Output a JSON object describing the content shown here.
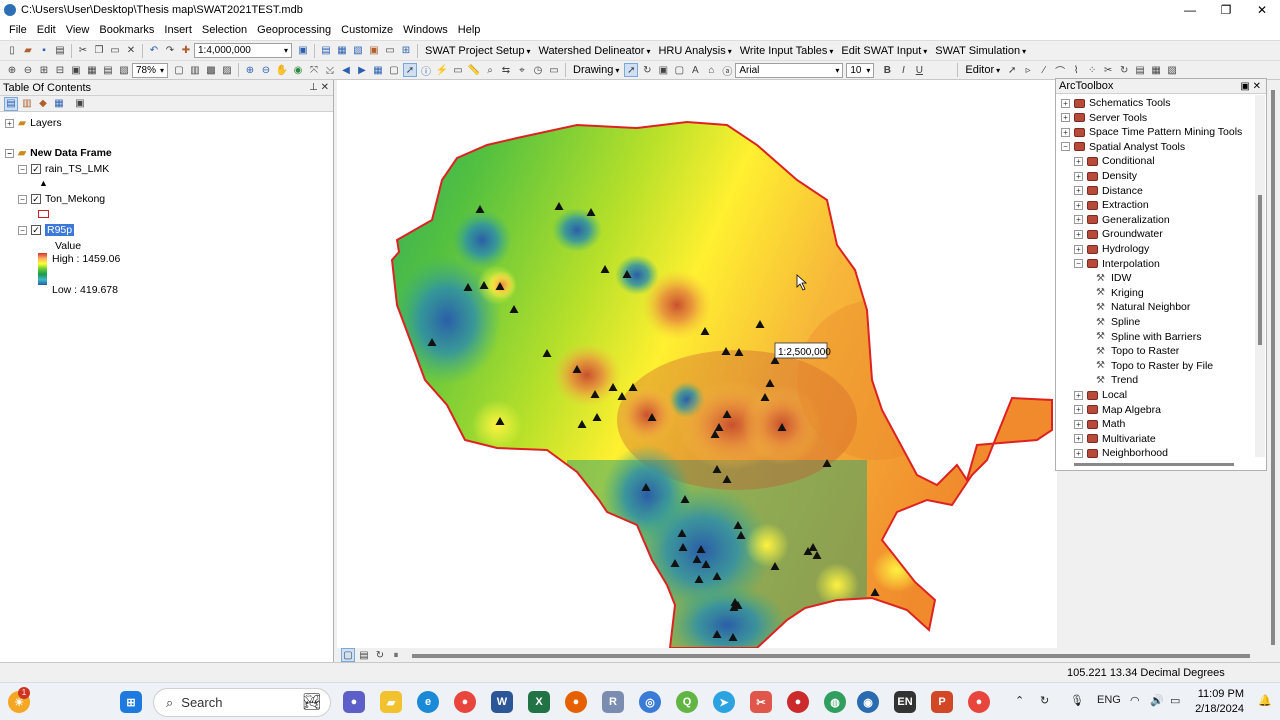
{
  "window": {
    "title": "C:\\Users\\User\\Desktop\\Thesis map\\SWAT2021TEST.mdb",
    "controls": [
      "—",
      "❐",
      "✕"
    ]
  },
  "menu": [
    "File",
    "Edit",
    "View",
    "Bookmarks",
    "Insert",
    "Selection",
    "Geoprocessing",
    "Customize",
    "Windows",
    "Help"
  ],
  "toolbar1": {
    "scale_value": "1:4,000,000",
    "swat_menus": [
      "SWAT Project Setup",
      "Watershed Delineator",
      "HRU Analysis",
      "Write Input Tables",
      "Edit SWAT Input",
      "SWAT Simulation"
    ]
  },
  "toolbar2": {
    "zoom_percent": "78%",
    "drawing_label": "Drawing",
    "font_name": "Arial",
    "font_size": "10",
    "bold": "B",
    "italic": "I",
    "underline": "U",
    "editor_label": "Editor"
  },
  "toc": {
    "title": "Table Of Contents",
    "layers_label": "Layers",
    "data_frame": "New Data Frame",
    "layer1": "rain_TS_LMK",
    "layer2": "Ton_Mekong",
    "layer3": "R95p",
    "legend_value_label": "Value",
    "legend_high": "High : 1459.06",
    "legend_low": "Low : 419.678"
  },
  "map": {
    "scale_tip": "1:2,500,000",
    "ramp_colors": [
      "#d73027",
      "#fdae61",
      "#ffff33",
      "#66cc33",
      "#1a9850",
      "#41b6c4",
      "#225ea8"
    ],
    "boundary_color": "#dd2222"
  },
  "toolbox": {
    "title": "ArcToolbox",
    "top_items": [
      "Schematics Tools",
      "Server Tools",
      "Space Time Pattern Mining Tools",
      "Spatial Analyst Tools"
    ],
    "spatial_children": [
      "Conditional",
      "Density",
      "Distance",
      "Extraction",
      "Generalization",
      "Groundwater",
      "Hydrology",
      "Interpolation"
    ],
    "interpolation_tools": [
      "IDW",
      "Kriging",
      "Natural Neighbor",
      "Spline",
      "Spline with Barriers",
      "Topo to Raster",
      "Topo to Raster by File",
      "Trend"
    ],
    "after_items": [
      "Local",
      "Map Algebra",
      "Math",
      "Multivariate",
      "Neighborhood"
    ]
  },
  "status": {
    "coordinates": "105.221  13.34 Decimal Degrees"
  },
  "taskbar": {
    "search_placeholder": "Search",
    "language": "ENG",
    "en_badge": "EN",
    "time": "11:09 PM",
    "date": "2/18/2024",
    "notif_count": "1"
  }
}
